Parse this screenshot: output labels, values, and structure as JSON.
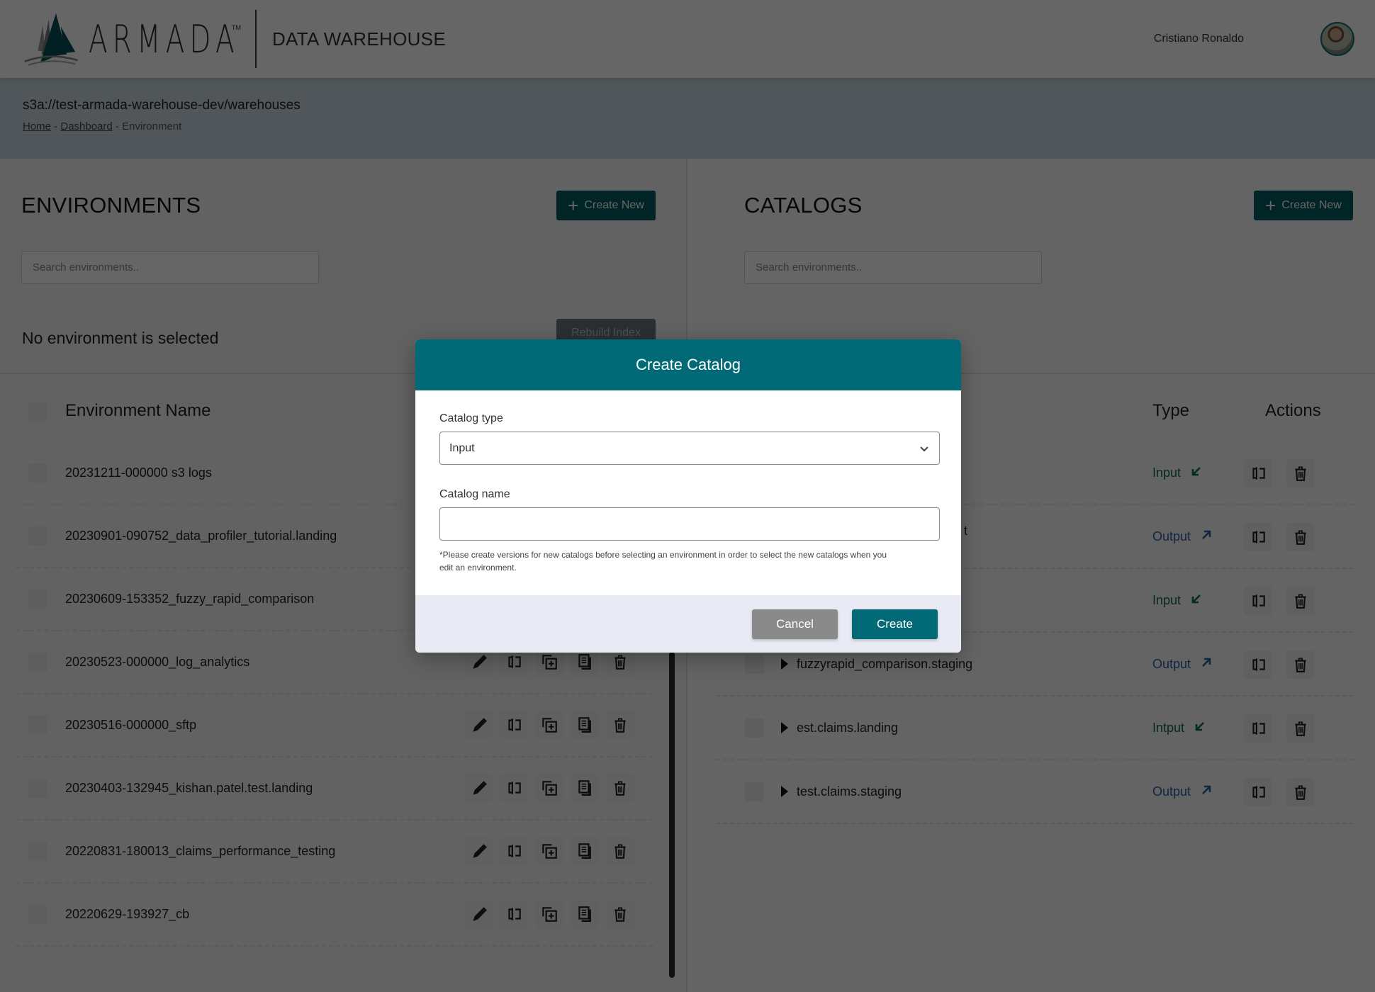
{
  "header": {
    "brand": "ARMADA",
    "trademark": "TM",
    "product": "DATA WAREHOUSE",
    "user_name": "Cristiano Ronaldo"
  },
  "breadcrumb_band": {
    "path": "s3a://test-armada-warehouse-dev/warehouses",
    "crumbs": [
      {
        "label": "Home",
        "link": true
      },
      {
        "label": "Dashboard",
        "link": true
      },
      {
        "label": "Environment",
        "link": false
      }
    ],
    "separator": " - "
  },
  "environments": {
    "title": "ENVIRONMENTS",
    "create_label": "Create New",
    "search_placeholder": "Search environments..",
    "status": "No environment is selected",
    "rebuild_label": "Rebuild Index",
    "column_header": "Environment Name",
    "rows": [
      {
        "name": "20231211-000000 s3 logs",
        "show_actions": false
      },
      {
        "name": "20230901-090752_data_profiler_tutorial.landing",
        "show_actions": false
      },
      {
        "name": "20230609-153352_fuzzy_rapid_comparison",
        "show_actions": false
      },
      {
        "name": "20230523-000000_log_analytics",
        "show_actions": true
      },
      {
        "name": "20230516-000000_sftp",
        "show_actions": true
      },
      {
        "name": "20230403-132945_kishan.patel.test.landing",
        "show_actions": true
      },
      {
        "name": "20220831-180013_claims_performance_testing",
        "show_actions": true
      },
      {
        "name": "20220629-193927_cb",
        "show_actions": true
      }
    ],
    "row_actions": [
      "edit-icon",
      "disconnect-icon",
      "add-copy-icon",
      "duplicate-icon",
      "trash-icon"
    ]
  },
  "catalogs": {
    "title": "CATALOGS",
    "create_label": "Create New",
    "search_placeholder": "Search environments..",
    "columns": {
      "type": "Type",
      "actions": "Actions"
    },
    "rows": [
      {
        "name": "",
        "type": "Input",
        "direction": "input"
      },
      {
        "name": "",
        "type": "Output",
        "direction": "output"
      },
      {
        "name": "",
        "type": "Input",
        "direction": "input"
      },
      {
        "name": "fuzzyrapid_comparison.staging",
        "type": "Output",
        "direction": "output"
      },
      {
        "name": "est.claims.landing",
        "type": "Intput",
        "direction": "input"
      },
      {
        "name": "test.claims.staging",
        "type": "Output",
        "direction": "output"
      }
    ],
    "partial_text_row2": "t"
  },
  "modal": {
    "title": "Create Catalog",
    "type_label": "Catalog type",
    "type_value": "Input",
    "name_label": "Catalog name",
    "name_value": "",
    "hint": "*Please create versions for new catalogs before selecting an environment in order to select the new catalogs when you edit an environment.",
    "cancel_label": "Cancel",
    "create_label": "Create"
  },
  "colors": {
    "brand_teal": "#026a77",
    "dark_teal": "#045b62",
    "input_color": "#0a6b5a",
    "output_color": "#2c5fa6"
  }
}
